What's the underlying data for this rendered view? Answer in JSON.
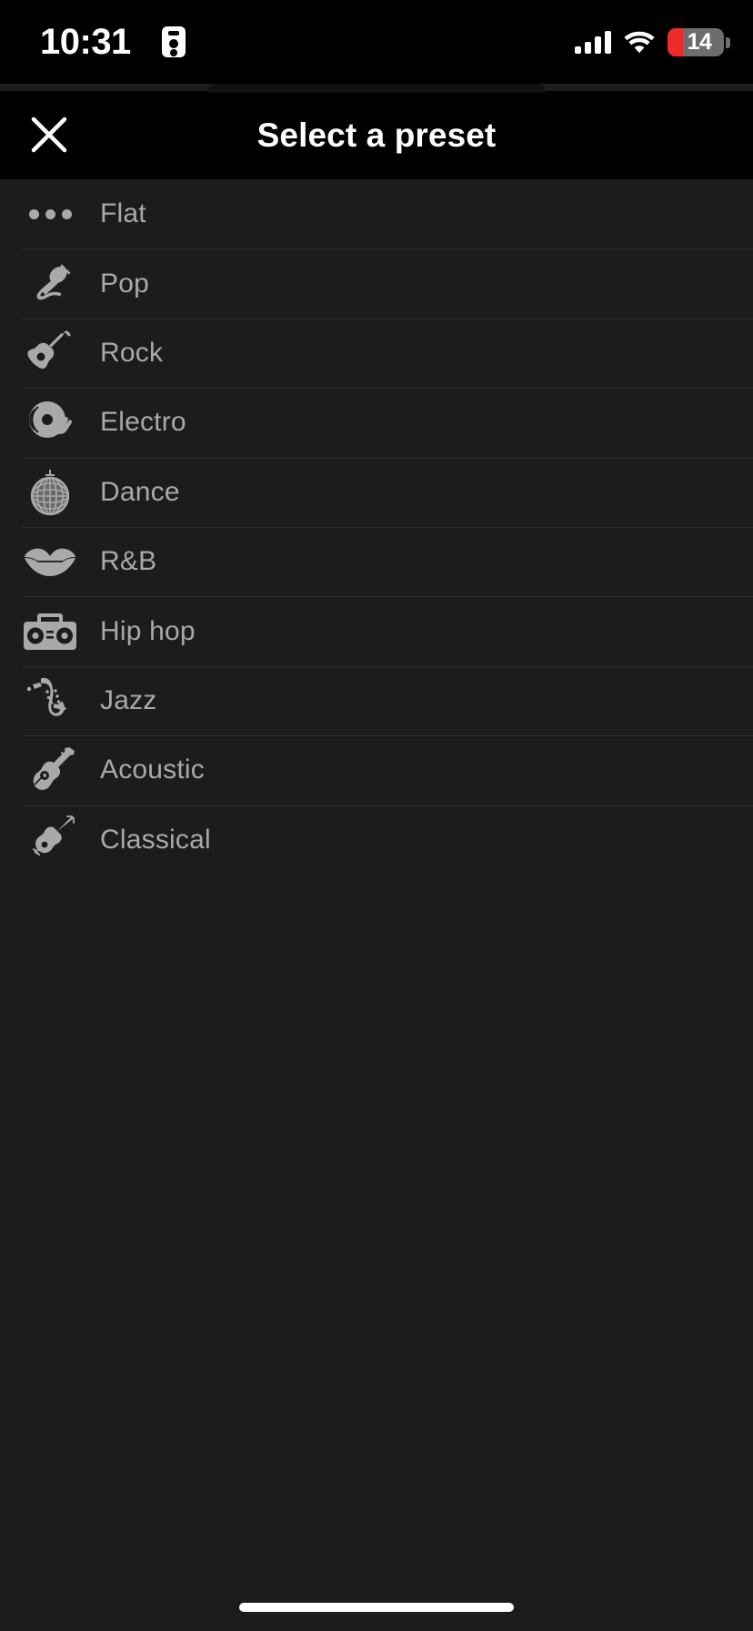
{
  "status_bar": {
    "time": "10:31",
    "id_icon": "id-card-icon",
    "signal_icon": "cellular-signal-icon",
    "signal_bars": 4,
    "wifi_icon": "wifi-icon",
    "battery_percent": "14",
    "battery_color": "#ef2a2a",
    "battery_body_color": "#6d6d6d"
  },
  "header": {
    "close_label": "✕",
    "close_icon": "close-icon",
    "title": "Select a preset"
  },
  "list": {
    "background": "#1c1c1c",
    "divider_color": "#2c2c2c",
    "label_color": "#a9a9a9",
    "items": [
      {
        "label": "Flat",
        "icon": "three-dots-icon"
      },
      {
        "label": "Pop",
        "icon": "microphone-icon"
      },
      {
        "label": "Rock",
        "icon": "electric-guitar-icon"
      },
      {
        "label": "Electro",
        "icon": "turntable-dj-icon"
      },
      {
        "label": "Dance",
        "icon": "disco-ball-icon"
      },
      {
        "label": "R&B",
        "icon": "lips-icon"
      },
      {
        "label": "Hip hop",
        "icon": "boombox-icon"
      },
      {
        "label": "Jazz",
        "icon": "saxophone-icon"
      },
      {
        "label": "Acoustic",
        "icon": "acoustic-guitar-icon"
      },
      {
        "label": "Classical",
        "icon": "violin-icon"
      }
    ]
  },
  "home_indicator": {
    "name": "home-indicator"
  }
}
